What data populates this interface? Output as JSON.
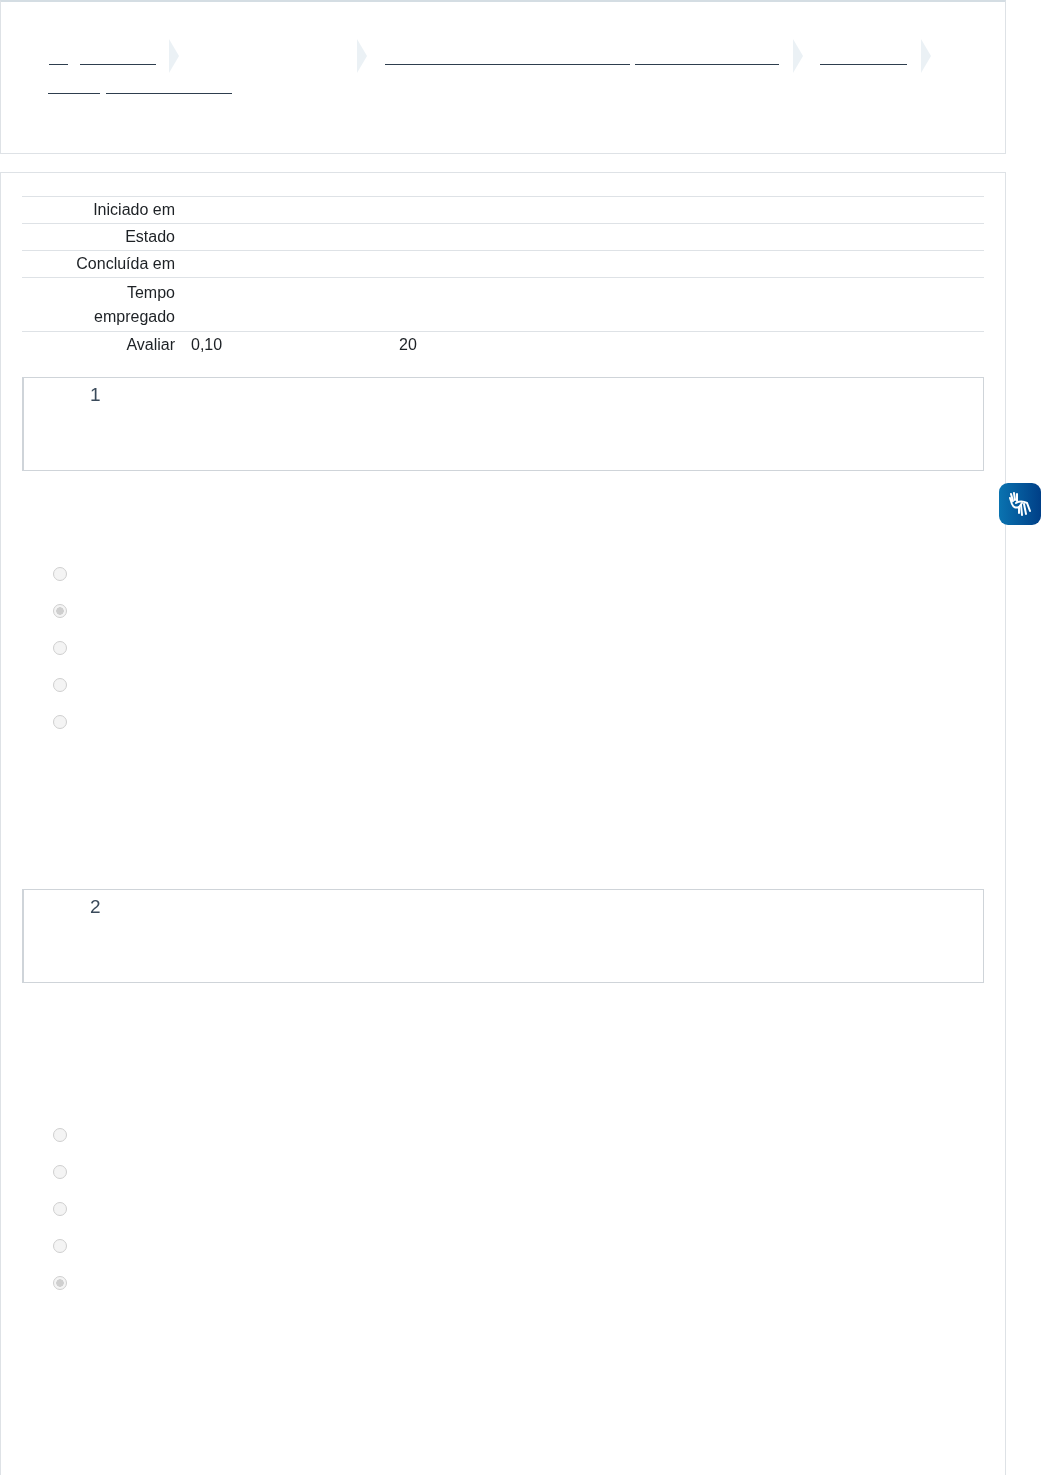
{
  "summary": [
    {
      "label": "Iniciado em"
    },
    {
      "label": "Estado"
    },
    {
      "label": "Concluída em"
    },
    {
      "label": "Tempo empregado"
    },
    {
      "label": "Avaliar",
      "value": "0,10",
      "extra": "20"
    }
  ],
  "questions": [
    {
      "number": "1",
      "options": [
        {
          "selected": false
        },
        {
          "selected": true
        },
        {
          "selected": false
        },
        {
          "selected": false
        },
        {
          "selected": false
        }
      ]
    },
    {
      "number": "2",
      "options": [
        {
          "selected": false
        },
        {
          "selected": false
        },
        {
          "selected": false
        },
        {
          "selected": false
        },
        {
          "selected": true
        }
      ]
    }
  ]
}
